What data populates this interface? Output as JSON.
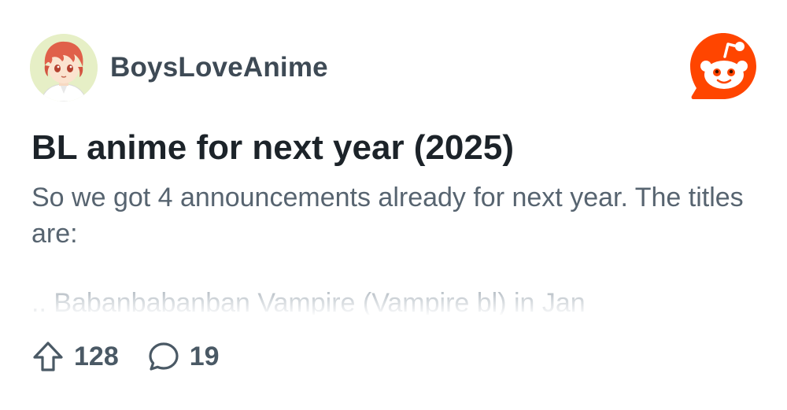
{
  "post": {
    "community": "BoysLoveAnime",
    "title": "BL anime for next year (2025)",
    "body": "So we got 4 announcements already for next year. The titles are:",
    "preview_line": ".. Babanbabanban Vampire (Vampire bl) in Jan",
    "upvotes": "128",
    "comments": "19"
  },
  "icons": {
    "avatar": "anime-avatar",
    "brand": "reddit-logo-icon",
    "upvote": "upvote-arrow-icon",
    "comment": "comment-bubble-icon"
  },
  "colors": {
    "brand_orange": "#ff4500",
    "title_text": "#1c2329",
    "body_text": "#576470",
    "action_text": "#4a5965"
  }
}
